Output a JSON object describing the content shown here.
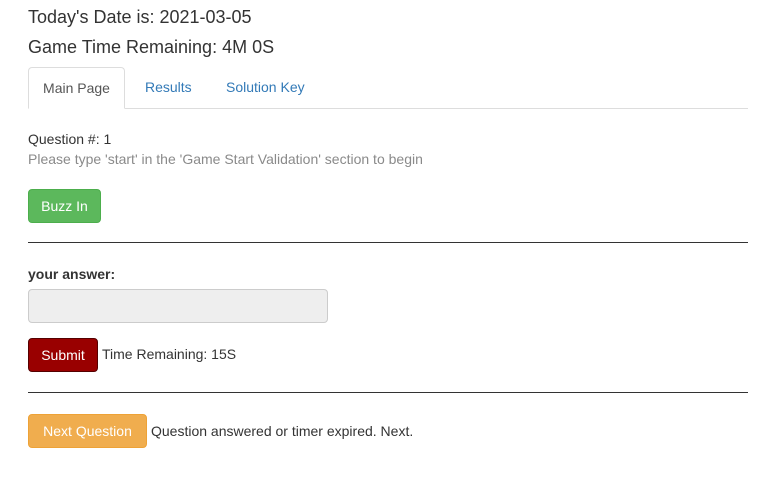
{
  "header": {
    "date_line": "Today's Date is: 2021-03-05",
    "time_line": "Game Time Remaining: 4M 0S"
  },
  "tabs": [
    {
      "label": "Main Page",
      "active": true
    },
    {
      "label": "Results",
      "active": false
    },
    {
      "label": "Solution Key",
      "active": false
    }
  ],
  "question": {
    "number_label": "Question #: 1",
    "help_text": "Please type 'start' in the 'Game Start Validation' section to begin"
  },
  "buzz": {
    "label": "Buzz In"
  },
  "answer": {
    "label": "your answer:",
    "value": "",
    "placeholder": ""
  },
  "submit": {
    "label": "Submit",
    "timer_text": "Time Remaining: 15S"
  },
  "next": {
    "label": "Next Question",
    "status_text": "Question answered or timer expired. Next."
  },
  "colors": {
    "buzz_green": "#5cb85c",
    "submit_red": "#990000",
    "next_orange": "#f0ad4e",
    "link_blue": "#337ab7",
    "muted_gray": "#8a8a8a"
  }
}
